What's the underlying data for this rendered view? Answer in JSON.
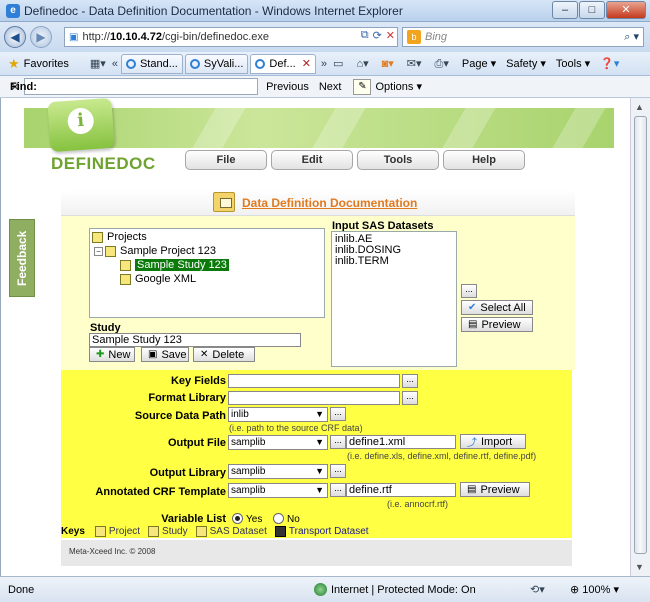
{
  "window": {
    "title": "Definedoc - Data Definition Documentation - Windows Internet Explorer",
    "min_label": "–",
    "max_label": "□",
    "close_label": "✕"
  },
  "address": {
    "url_prefix": "http://",
    "url_host": "10.10.4.72",
    "url_path": "/cgi-bin/definedoc.exe",
    "search_placeholder": "Bing"
  },
  "favorites": {
    "label": "Favorites",
    "tabs": [
      {
        "label": "Stand..."
      },
      {
        "label": "SyVali..."
      },
      {
        "label": "Def..."
      }
    ],
    "more": "»",
    "commands": [
      "Page",
      "Safety",
      "Tools"
    ]
  },
  "find": {
    "label": "Find:",
    "value": "",
    "previous": "Previous",
    "next": "Next",
    "options": "Options"
  },
  "status": {
    "text": "Done",
    "zone": "Internet | Protected Mode: On",
    "zoom": "100%"
  },
  "app": {
    "logo_text": "DEFINEDOC",
    "feedback": "Feedback",
    "menu": [
      "File",
      "Edit",
      "Tools",
      "Help"
    ],
    "heading": "Data Definition Documentation"
  },
  "projects": {
    "root": "Projects",
    "project": "Sample Project 123",
    "selected_study": "Sample Study 123",
    "other_study": "Google XML"
  },
  "datasets": {
    "label": "Input SAS Datasets",
    "items": [
      "inlib.AE",
      "inlib.DOSING",
      "inlib.TERM"
    ],
    "more_button": "...",
    "select_all": "Select All",
    "preview": "Preview"
  },
  "study": {
    "label": "Study",
    "value": "Sample Study 123",
    "new": "New",
    "save": "Save",
    "delete": "Delete"
  },
  "form": {
    "key_fields": {
      "label": "Key Fields",
      "value": ""
    },
    "format_library": {
      "label": "Format Library",
      "value": ""
    },
    "source_data_path": {
      "label": "Source Data Path",
      "value": "inlib",
      "hint": "(i.e. path to the source CRF data)"
    },
    "output_file": {
      "label": "Output File",
      "lib": "samplib",
      "file": "define1.xml",
      "import": "Import",
      "hint": "(i.e. define.xls, define.xml, define.rtf, define.pdf)"
    },
    "output_library": {
      "label": "Output Library",
      "value": "samplib"
    },
    "annotated_crf": {
      "label": "Annotated CRF Template",
      "lib": "samplib",
      "file": "define.rtf",
      "preview": "Preview",
      "hint": "(i.e. annocrf.rtf)"
    },
    "variable_list": {
      "label": "Variable List",
      "yes": "Yes",
      "no": "No"
    },
    "ellipsis": "..."
  },
  "keys": {
    "label": "Keys",
    "items": [
      "Project",
      "Study",
      "SAS Dataset",
      "Transport Dataset"
    ]
  },
  "footer": {
    "copyright": "Meta-Xceed Inc. ©  2008"
  },
  "colors": {
    "accent_green": "#8fae62",
    "heading_orange": "#e07a1f",
    "selected_green": "#0b7a0b",
    "form_yellow": "#ffff44",
    "pane_yellow": "#ffffcc"
  }
}
